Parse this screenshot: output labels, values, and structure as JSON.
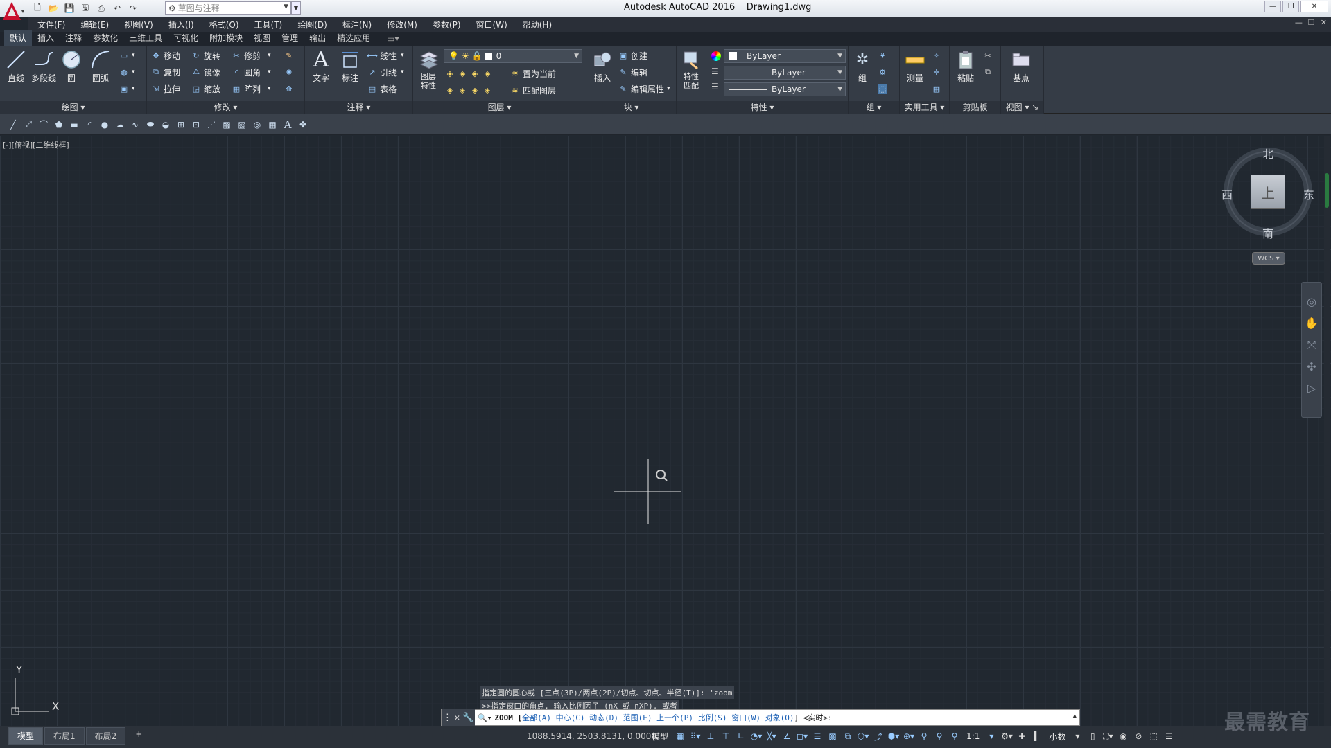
{
  "app": {
    "title": "Autodesk AutoCAD 2016    Drawing1.dwg",
    "workspace": "草图与注释"
  },
  "menus": [
    "文件(F)",
    "编辑(E)",
    "视图(V)",
    "插入(I)",
    "格式(O)",
    "工具(T)",
    "绘图(D)",
    "标注(N)",
    "修改(M)",
    "参数(P)",
    "窗口(W)",
    "帮助(H)"
  ],
  "ribbon_tabs": [
    "默认",
    "插入",
    "注释",
    "参数化",
    "三维工具",
    "可视化",
    "附加模块",
    "视图",
    "管理",
    "输出",
    "精选应用"
  ],
  "ribbon": {
    "draw": {
      "title": "绘图",
      "line": "直线",
      "polyline": "多段线",
      "circle": "圆",
      "arc": "圆弧"
    },
    "modify": {
      "title": "修改",
      "move": "移动",
      "rotate": "旋转",
      "trim": "修剪",
      "copy": "复制",
      "mirror": "镜像",
      "fillet": "圆角",
      "stretch": "拉伸",
      "scale": "缩放",
      "array": "阵列"
    },
    "annotation": {
      "title": "注释",
      "text": "文字",
      "dimension": "标注",
      "linear": "线性",
      "leader": "引线",
      "table": "表格"
    },
    "layers": {
      "title": "图层",
      "props": "图层特性",
      "current_layer": "0",
      "set_current": "置为当前",
      "match_layer": "匹配图层"
    },
    "block": {
      "title": "块",
      "insert": "插入",
      "create": "创建",
      "edit": "编辑",
      "edit_attr": "编辑属性"
    },
    "properties": {
      "title": "特性",
      "match": "特性匹配",
      "color": "ByLayer",
      "linetype": "ByLayer",
      "lineweight": "ByLayer"
    },
    "groups": {
      "title": "组",
      "group": "组"
    },
    "utilities": {
      "title": "实用工具",
      "measure": "测量"
    },
    "clipboard": {
      "title": "剪贴板",
      "paste": "粘贴"
    },
    "view": {
      "title": "视图",
      "base": "基点"
    }
  },
  "viewport_label": "[-][俯视][二维线框]",
  "viewcube": {
    "north": "北",
    "south": "南",
    "east": "东",
    "west": "西",
    "top": "上",
    "wcs": "WCS"
  },
  "ucs": {
    "x": "X",
    "y": "Y"
  },
  "command": {
    "history": [
      "指定圆的圆心或 [三点(3P)/两点(2P)/切点、切点、半径(T)]: 'zoom",
      ">>指定窗口的角点, 输入比例因子 (nX 或 nXP), 或者"
    ],
    "prefix": "ZOOM [",
    "options": [
      "全部(A)",
      "中心(C)",
      "动态(D)",
      "范围(E)",
      "上一个(P)",
      "比例(S)",
      "窗口(W)",
      "对象(O)"
    ],
    "suffix": "] <实时>:"
  },
  "layout_tabs": [
    "模型",
    "布局1",
    "布局2"
  ],
  "status": {
    "coords": "1088.5914, 2503.8131, 0.0000",
    "model": "模型",
    "scale": "1:1",
    "units": "小数"
  },
  "watermark": "最需教育"
}
